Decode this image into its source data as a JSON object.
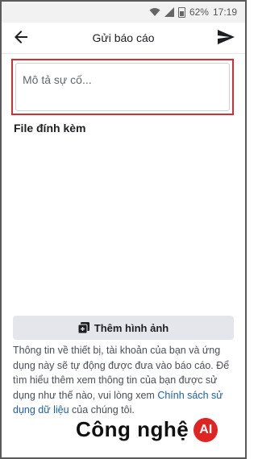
{
  "status_bar": {
    "battery_percent": "62%",
    "time": "17:19"
  },
  "header": {
    "title": "Gửi báo cáo"
  },
  "description": {
    "placeholder": "Mô tả sự cố..."
  },
  "attachments": {
    "title": "File đính kèm",
    "add_photo_label": "Thêm hình ảnh"
  },
  "info": {
    "text": "Thông tin về thiết bị, tài khoản của bạn và ứng dụng này sẽ tự động được đưa vào báo cáo. Để tìm hiểu thêm xem thông tin của bạn được sử dụng như thế nào, vui lòng xem ",
    "link": "Chính sách sử dụng dữ liệu",
    "suffix": " của chúng tôi."
  },
  "watermark": {
    "text": "Công nghệ",
    "logo": "AI"
  },
  "colors": {
    "highlight": "#d32f2f",
    "link": "#1b5fa8",
    "button_bg": "#e4e6eb"
  },
  "icons": [
    "wifi-icon",
    "signal-icon",
    "battery-icon",
    "back-arrow-icon",
    "send-icon",
    "add-photo-icon"
  ]
}
